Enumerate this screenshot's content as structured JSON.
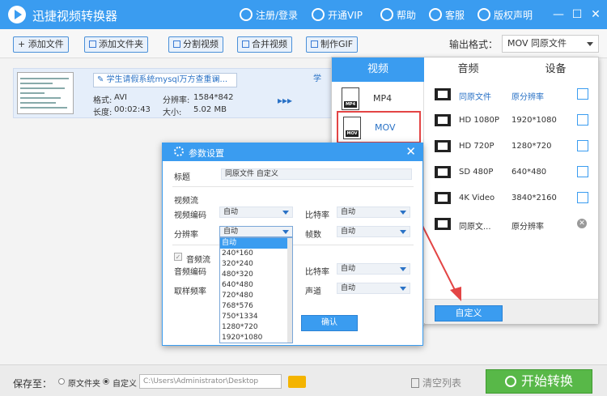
{
  "app": {
    "title": "迅捷视频转换器"
  },
  "titlebar": {
    "register": "注册/登录",
    "vip": "开通VIP",
    "help": "帮助",
    "service": "客服",
    "copyright": "版权声明"
  },
  "toolbar": {
    "add_file": "添加文件",
    "add_folder": "添加文件夹",
    "split": "分割视频",
    "merge": "合并视频",
    "gif": "制作GIF",
    "format_label": "输出格式：",
    "format_value": "MOV  同原文件"
  },
  "file": {
    "name": "学生请假系统mysql万方查重谰...",
    "name2": "学",
    "format_label": "格式:",
    "format": "AVI",
    "resolution_label": "分辨率:",
    "resolution": "1584*842",
    "duration_label": "长度:",
    "duration": "00:02:43",
    "size_label": "大小:",
    "size": "5.02 MB",
    "arrow": "▸▸▸"
  },
  "format_panel": {
    "tabs": [
      "视频",
      "音频",
      "设备"
    ],
    "formats": [
      "MP4",
      "MOV"
    ],
    "rows": [
      {
        "name": "同原文件",
        "res": "原分辨率"
      },
      {
        "name": "HD 1080P",
        "res": "1920*1080"
      },
      {
        "name": "HD 720P",
        "res": "1280*720"
      },
      {
        "name": "SD 480P",
        "res": "640*480"
      },
      {
        "name": "4K Video",
        "res": "3840*2160"
      },
      {
        "name": "同原文...",
        "res": "原分辨率"
      }
    ],
    "custom_button": "自定义"
  },
  "dialog": {
    "title": "参数设置",
    "label_title": "标题",
    "title_value": "同原文件 自定义",
    "video_stream": "视频流",
    "video_codec": "视频编码",
    "video_codec_value": "自动",
    "bitrate": "比特率",
    "bitrate_value": "自动",
    "resolution": "分辨率",
    "resolution_value": "自动",
    "fps": "帧数",
    "fps_value": "自动",
    "audio_stream": "音频流",
    "audio_codec": "音频编码",
    "audio_bitrate": "比特率",
    "audio_bitrate_value": "自动",
    "sample_rate": "取样频率",
    "channel": "声道",
    "channel_value": "自动",
    "ok": "确认",
    "dropdown_options": [
      "自动",
      "240*160",
      "320*240",
      "480*320",
      "640*480",
      "720*480",
      "768*576",
      "750*1334",
      "1280*720",
      "1920*1080"
    ]
  },
  "bottom": {
    "save_label": "保存至：",
    "opt_source": "原文件夹",
    "opt_custom": "自定义",
    "path": "C:\\Users\\Administrator\\Desktop",
    "clear": "清空列表",
    "start": "开始转换"
  },
  "colors": {
    "accent": "#3a9cf0",
    "start": "#58b848",
    "highlight": "#e34545"
  }
}
